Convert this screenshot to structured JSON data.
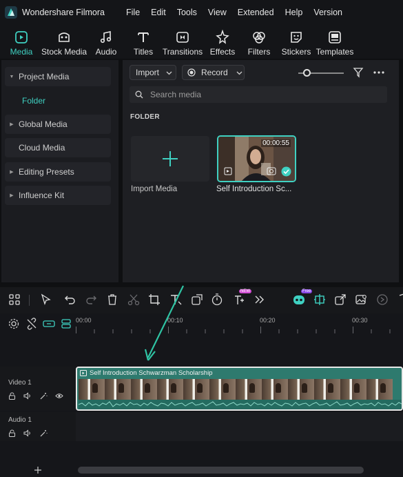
{
  "app": {
    "title": "Wondershare Filmora"
  },
  "menu": [
    "File",
    "Edit",
    "Tools",
    "View",
    "Extended",
    "Help",
    "Version"
  ],
  "ribbon": [
    {
      "label": "Media",
      "icon": "media-icon",
      "active": true
    },
    {
      "label": "Stock Media",
      "icon": "stock-media-icon"
    },
    {
      "label": "Audio",
      "icon": "audio-icon"
    },
    {
      "label": "Titles",
      "icon": "titles-icon"
    },
    {
      "label": "Transitions",
      "icon": "transitions-icon"
    },
    {
      "label": "Effects",
      "icon": "effects-icon"
    },
    {
      "label": "Filters",
      "icon": "filters-icon"
    },
    {
      "label": "Stickers",
      "icon": "stickers-icon"
    },
    {
      "label": "Templates",
      "icon": "templates-icon"
    }
  ],
  "sidebar": {
    "items": [
      {
        "label": "Project Media",
        "expanded": true
      },
      {
        "label": "Global Media"
      },
      {
        "label": "Cloud Media"
      },
      {
        "label": "Editing Presets"
      },
      {
        "label": "Influence Kit"
      }
    ],
    "folder": "Folder"
  },
  "media": {
    "import_label": "Import",
    "record_label": "Record",
    "search_placeholder": "Search media",
    "section_title": "FOLDER",
    "import_media_label": "Import Media",
    "clip": {
      "name": "Self Introduction Sc...",
      "duration": "00:00:55"
    }
  },
  "timeline": {
    "ruler": [
      "00:00",
      "00:10",
      "00:20",
      "00:30"
    ],
    "tracks": [
      {
        "label": "Video 1"
      },
      {
        "label": "Audio 1"
      }
    ],
    "clip_title": "Self Introduction Schwarzman Scholarship",
    "badges": {
      "new": "NEW",
      "free": "Free"
    }
  },
  "colors": {
    "accent": "#3fd1c2",
    "arrow": "#2fc4a4"
  }
}
